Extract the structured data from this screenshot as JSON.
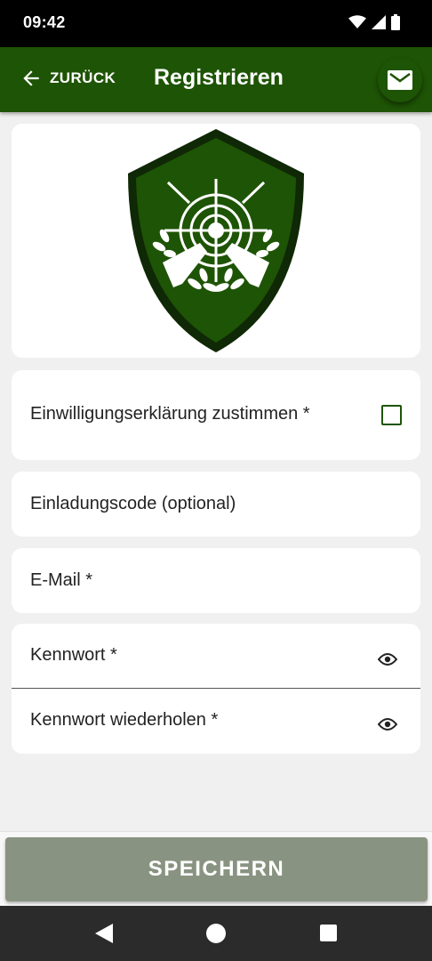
{
  "status_bar": {
    "time": "09:42",
    "icons": [
      "wifi-icon",
      "signal-icon",
      "battery-icon"
    ]
  },
  "app_bar": {
    "back_label": "ZURÜCK",
    "title": "Registrieren",
    "action_icon": "mail-icon"
  },
  "logo": {
    "icon": "shooting-club-shield-logo"
  },
  "consent": {
    "label": "Einwilligungserklärung zustimmen *",
    "checked": false
  },
  "invite_code": {
    "label": "Einladungscode (optional)"
  },
  "email": {
    "label": "E-Mail *"
  },
  "password": {
    "label": "Kennwort *",
    "toggle_icon": "eye-icon"
  },
  "password_repeat": {
    "label": "Kennwort wiederholen *",
    "toggle_icon": "eye-icon"
  },
  "save_button": {
    "label": "SPEICHERN"
  },
  "colors": {
    "primary": "#1e5405",
    "button_disabled": "#899381",
    "background": "#f0f0f0"
  }
}
